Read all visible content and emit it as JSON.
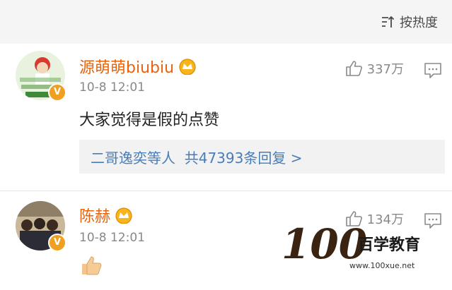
{
  "sort": {
    "label": "按热度",
    "icon": "sort-icon"
  },
  "comments": [
    {
      "username": "源萌萌biubiu",
      "time": "10-8 12:01",
      "likes": "337万",
      "text": "大家觉得是假的点赞",
      "replies": {
        "names": "二哥逸奕等人",
        "summary": "共47393条回复 >"
      }
    },
    {
      "username": "陈赫",
      "time": "10-8 12:01",
      "likes": "134万",
      "text_icon": "thumbs-up-emoji"
    }
  ],
  "watermark": {
    "brand": "百学教育",
    "url": "www.100xue.net"
  },
  "colors": {
    "username": "#e8630c",
    "reply_link": "#4a7db5",
    "verified": "#f0a020"
  }
}
